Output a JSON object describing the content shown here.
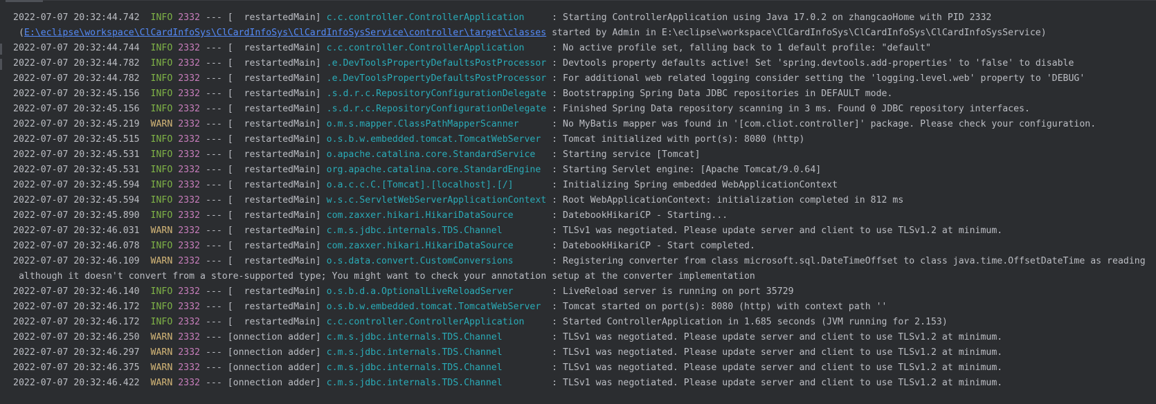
{
  "lines": [
    {
      "ts": "2022-07-07 20:32:44.742",
      "level": "INFO",
      "pid": "2332",
      "thread": "  restartedMain",
      "logger": "c.c.controller.ControllerApplication    ",
      "msg": "Starting ControllerApplication using Java 17.0.2 on zhangcaoHome with PID 2332"
    },
    {
      "cont_prefix": "(",
      "link": "E:\\eclipse\\workspace\\ClCardInfoSys\\ClCardInfoSys\\ClCardInfoSysService\\controller\\target\\classes",
      "cont_suffix": " started by Admin in E:\\eclipse\\workspace\\ClCardInfoSys\\ClCardInfoSys\\ClCardInfoSysService)"
    },
    {
      "ts": "2022-07-07 20:32:44.744",
      "level": "INFO",
      "pid": "2332",
      "thread": "  restartedMain",
      "logger": "c.c.controller.ControllerApplication    ",
      "msg": "No active profile set, falling back to 1 default profile: \"default\""
    },
    {
      "ts": "2022-07-07 20:32:44.782",
      "level": "INFO",
      "pid": "2332",
      "thread": "  restartedMain",
      "logger": ".e.DevToolsPropertyDefaultsPostProcessor",
      "msg": "Devtools property defaults active! Set 'spring.devtools.add-properties' to 'false' to disable"
    },
    {
      "ts": "2022-07-07 20:32:44.782",
      "level": "INFO",
      "pid": "2332",
      "thread": "  restartedMain",
      "logger": ".e.DevToolsPropertyDefaultsPostProcessor",
      "msg": "For additional web related logging consider setting the 'logging.level.web' property to 'DEBUG'"
    },
    {
      "ts": "2022-07-07 20:32:45.156",
      "level": "INFO",
      "pid": "2332",
      "thread": "  restartedMain",
      "logger": ".s.d.r.c.RepositoryConfigurationDelegate",
      "msg": "Bootstrapping Spring Data JDBC repositories in DEFAULT mode."
    },
    {
      "ts": "2022-07-07 20:32:45.156",
      "level": "INFO",
      "pid": "2332",
      "thread": "  restartedMain",
      "logger": ".s.d.r.c.RepositoryConfigurationDelegate",
      "msg": "Finished Spring Data repository scanning in 3 ms. Found 0 JDBC repository interfaces."
    },
    {
      "ts": "2022-07-07 20:32:45.219",
      "level": "WARN",
      "pid": "2332",
      "thread": "  restartedMain",
      "logger": "o.m.s.mapper.ClassPathMapperScanner     ",
      "msg": "No MyBatis mapper was found in '[com.cliot.controller]' package. Please check your configuration."
    },
    {
      "ts": "2022-07-07 20:32:45.515",
      "level": "INFO",
      "pid": "2332",
      "thread": "  restartedMain",
      "logger": "o.s.b.w.embedded.tomcat.TomcatWebServer ",
      "msg": "Tomcat initialized with port(s): 8080 (http)"
    },
    {
      "ts": "2022-07-07 20:32:45.531",
      "level": "INFO",
      "pid": "2332",
      "thread": "  restartedMain",
      "logger": "o.apache.catalina.core.StandardService  ",
      "msg": "Starting service [Tomcat]"
    },
    {
      "ts": "2022-07-07 20:32:45.531",
      "level": "INFO",
      "pid": "2332",
      "thread": "  restartedMain",
      "logger": "org.apache.catalina.core.StandardEngine ",
      "msg": "Starting Servlet engine: [Apache Tomcat/9.0.64]"
    },
    {
      "ts": "2022-07-07 20:32:45.594",
      "level": "INFO",
      "pid": "2332",
      "thread": "  restartedMain",
      "logger": "o.a.c.c.C.[Tomcat].[localhost].[/]      ",
      "msg": "Initializing Spring embedded WebApplicationContext"
    },
    {
      "ts": "2022-07-07 20:32:45.594",
      "level": "INFO",
      "pid": "2332",
      "thread": "  restartedMain",
      "logger": "w.s.c.ServletWebServerApplicationContext",
      "msg": "Root WebApplicationContext: initialization completed in 812 ms"
    },
    {
      "ts": "2022-07-07 20:32:45.890",
      "level": "INFO",
      "pid": "2332",
      "thread": "  restartedMain",
      "logger": "com.zaxxer.hikari.HikariDataSource      ",
      "msg": "DatebookHikariCP - Starting..."
    },
    {
      "ts": "2022-07-07 20:32:46.031",
      "level": "WARN",
      "pid": "2332",
      "thread": "  restartedMain",
      "logger": "c.m.s.jdbc.internals.TDS.Channel        ",
      "msg": "TLSv1 was negotiated. Please update server and client to use TLSv1.2 at minimum."
    },
    {
      "ts": "2022-07-07 20:32:46.078",
      "level": "INFO",
      "pid": "2332",
      "thread": "  restartedMain",
      "logger": "com.zaxxer.hikari.HikariDataSource      ",
      "msg": "DatebookHikariCP - Start completed."
    },
    {
      "ts": "2022-07-07 20:32:46.109",
      "level": "WARN",
      "pid": "2332",
      "thread": "  restartedMain",
      "logger": "o.s.data.convert.CustomConversions      ",
      "msg": "Registering converter from class microsoft.sql.DateTimeOffset to class java.time.OffsetDateTime as reading"
    },
    {
      "cont_prefix": "although it doesn't convert from a store-supported type; You might want to check your annotation setup at the converter implementation"
    },
    {
      "ts": "2022-07-07 20:32:46.140",
      "level": "INFO",
      "pid": "2332",
      "thread": "  restartedMain",
      "logger": "o.s.b.d.a.OptionalLiveReloadServer      ",
      "msg": "LiveReload server is running on port 35729"
    },
    {
      "ts": "2022-07-07 20:32:46.172",
      "level": "INFO",
      "pid": "2332",
      "thread": "  restartedMain",
      "logger": "o.s.b.w.embedded.tomcat.TomcatWebServer ",
      "msg": "Tomcat started on port(s): 8080 (http) with context path ''"
    },
    {
      "ts": "2022-07-07 20:32:46.172",
      "level": "INFO",
      "pid": "2332",
      "thread": "  restartedMain",
      "logger": "c.c.controller.ControllerApplication    ",
      "msg": "Started ControllerApplication in 1.685 seconds (JVM running for 2.153)"
    },
    {
      "ts": "2022-07-07 20:32:46.250",
      "level": "WARN",
      "pid": "2332",
      "thread": "onnection adder",
      "logger": "c.m.s.jdbc.internals.TDS.Channel        ",
      "msg": "TLSv1 was negotiated. Please update server and client to use TLSv1.2 at minimum."
    },
    {
      "ts": "2022-07-07 20:32:46.297",
      "level": "WARN",
      "pid": "2332",
      "thread": "onnection adder",
      "logger": "c.m.s.jdbc.internals.TDS.Channel        ",
      "msg": "TLSv1 was negotiated. Please update server and client to use TLSv1.2 at minimum."
    },
    {
      "ts": "2022-07-07 20:32:46.375",
      "level": "WARN",
      "pid": "2332",
      "thread": "onnection adder",
      "logger": "c.m.s.jdbc.internals.TDS.Channel        ",
      "msg": "TLSv1 was negotiated. Please update server and client to use TLSv1.2 at minimum."
    },
    {
      "ts": "2022-07-07 20:32:46.422",
      "level": "WARN",
      "pid": "2332",
      "thread": "onnection adder",
      "logger": "c.m.s.jdbc.internals.TDS.Channel        ",
      "msg": "TLSv1 was negotiated. Please update server and client to use TLSv1.2 at minimum."
    }
  ],
  "colors": {
    "background": "#2b2d30",
    "text": "#bcbec4",
    "info": "#7fb347",
    "warn": "#d5b778",
    "pid": "#c77dbb",
    "logger": "#2aacb8",
    "link": "#548af7"
  }
}
